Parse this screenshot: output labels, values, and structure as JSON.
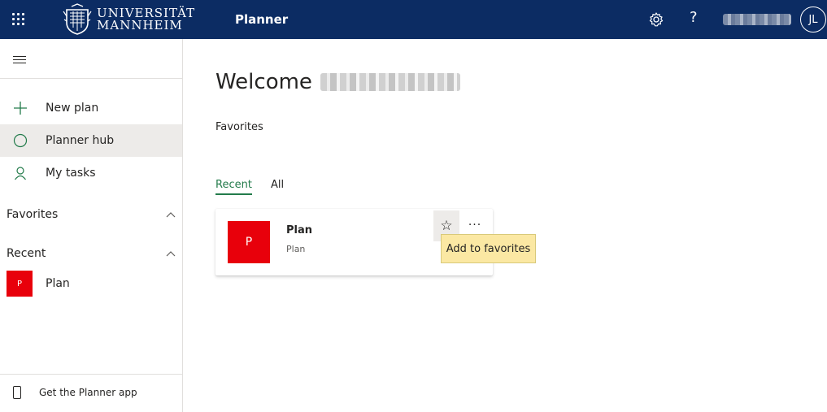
{
  "header": {
    "logo_line1": "UNIVERSITÄT",
    "logo_line2": "MANNHEIM",
    "app_name": "Planner",
    "avatar_initials": "JL",
    "accent_color": "#0c2c63"
  },
  "sidebar": {
    "nav": [
      {
        "label": "New plan",
        "icon": "plus-icon"
      },
      {
        "label": "Planner hub",
        "icon": "circle-icon"
      },
      {
        "label": "My tasks",
        "icon": "person-icon"
      }
    ],
    "favorites_label": "Favorites",
    "recent_label": "Recent",
    "recent_items": [
      {
        "tile_letter": "P",
        "label": "Plan"
      }
    ],
    "get_app_label": "Get the Planner app"
  },
  "main": {
    "welcome_text": "Welcome",
    "favorites_heading": "Favorites",
    "tabs": [
      {
        "label": "Recent",
        "selected": true
      },
      {
        "label": "All",
        "selected": false
      }
    ],
    "card": {
      "tile_letter": "P",
      "title": "Plan",
      "subtitle": "Plan",
      "more_label": "···",
      "tile_color": "#e8000b"
    },
    "tooltip": "Add to favorites"
  }
}
